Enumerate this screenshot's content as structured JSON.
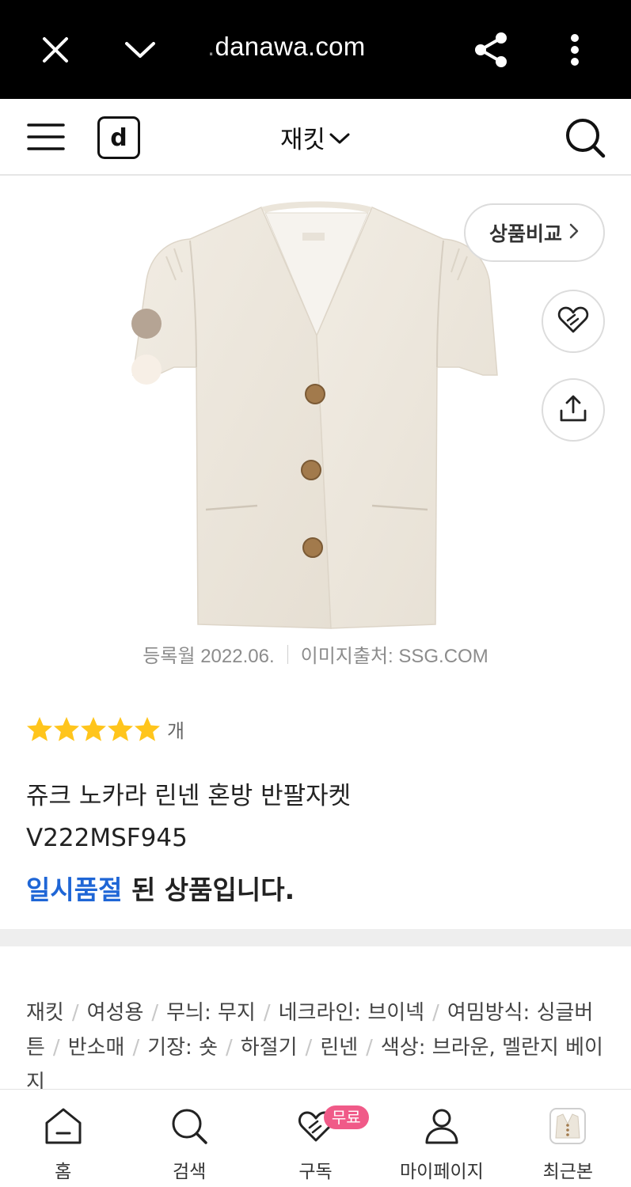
{
  "browser": {
    "url_prefix": ".",
    "url_domain": "danawa.com",
    "icons": [
      "close-icon",
      "chevron-down-icon",
      "share-icon",
      "more-vertical-icon"
    ]
  },
  "header": {
    "logo_letter": "d",
    "category": "재킷",
    "icons": [
      "menu-icon",
      "logo-icon",
      "chevron-down-icon",
      "search-icon"
    ]
  },
  "product_image": {
    "swatches": [
      "#b5a494",
      "#f7efe6"
    ],
    "compare_label": "상품비교",
    "register_date": "등록월 2022.06.",
    "image_source": "이미지출처: SSG.COM"
  },
  "product": {
    "rating_stars": 5,
    "rating_count_suffix": "개",
    "title_line1": "쥬크 노카라 린넨 혼방 반팔자켓",
    "title_line2": "V222MSF945",
    "soldout_highlight": "일시품절",
    "soldout_rest": " 된 상품입니다."
  },
  "specs": {
    "items": [
      "재킷",
      "여성용",
      "무늬: 무지",
      "네크라인: 브이넥",
      "여밈방식: 싱글버튼",
      "반소매",
      "기장: 숏",
      "하절기",
      "린넨",
      "색상: 브라운, 멜란지 베이지"
    ]
  },
  "bottom_nav": {
    "items": [
      {
        "label": "홈",
        "icon": "home-icon"
      },
      {
        "label": "검색",
        "icon": "search-icon"
      },
      {
        "label": "구독",
        "icon": "heart-icon",
        "badge": "무료"
      },
      {
        "label": "마이페이지",
        "icon": "person-icon"
      },
      {
        "label": "최근본",
        "icon": "recent-thumbnail"
      }
    ]
  },
  "colors": {
    "accent_blue": "#1f66d6",
    "star_yellow": "#ffc51c",
    "badge_pink": "#f05a88"
  }
}
